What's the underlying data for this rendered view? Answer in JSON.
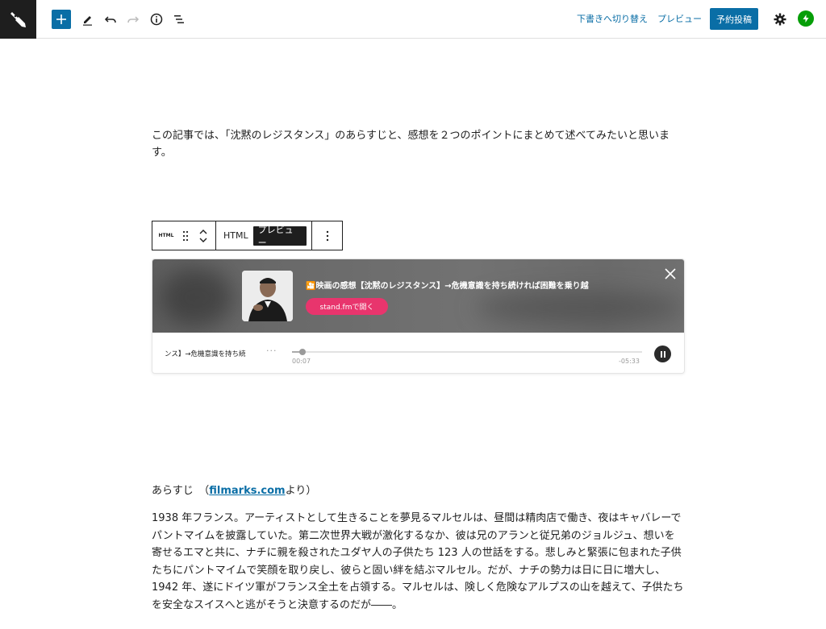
{
  "toolbar": {
    "switch_to_draft_label": "下書きへ切り替え",
    "preview_label": "プレビュー",
    "schedule_label": "予約投稿"
  },
  "content": {
    "intro": "この記事では、「沈黙のレジスタンス」のあらすじと、感想を２つのポイントにまとめて述べてみたいと思います。",
    "synopsis_heading_prefix": "あらすじ　（",
    "synopsis_link": "filmarks.com",
    "synopsis_heading_suffix": "より）",
    "synopsis_body": "1938 年フランス。アーティストとして生きることを夢見るマルセルは、昼間は精肉店で働き、夜はキャバレーでパントマイムを披露していた。第二次世界大戦が激化するなか、彼は兄のアランと従兄弟のジョルジュ、想いを寄せるエマと共に、ナチに親を殺されたユダヤ人の子供たち 123 人の世話をする。悲しみと緊張に包まれた子供たちにパントマイムで笑顔を取り戻し、彼らと固い絆を結ぶマルセル。だが、ナチの勢力は日に日に増大し、1942 年、遂にドイツ軍がフランス全土を占領する。マルセルは、険しく危険なアルプスの山を越えて、子供たちを安全なスイスへと逃がそうと決意するのだが――。"
  },
  "block_toolbar": {
    "block_icon_label": "HTML",
    "tab_html": "HTML",
    "tab_preview": "プレビュー"
  },
  "embed": {
    "title": "🎦映画の感想【沈黙のレジスタンス】→危機意識を持ち続ければ困難を乗り越",
    "button_label": "stand.fmで開く",
    "track_title": "ンス】→危機意識を持ち続",
    "dots": "···",
    "time_current": "00:07",
    "time_remaining": "-05:33",
    "progress": 0.03
  },
  "colors": {
    "accent": "#0a6ea6",
    "standfm_pink": "#e8356d",
    "jetpack_green": "#069e08"
  },
  "icons": [
    "wordpress-logo-icon",
    "plus-icon",
    "pencil-icon",
    "undo-icon",
    "redo-icon",
    "info-icon",
    "list-view-icon",
    "gear-icon",
    "jetpack-icon",
    "drag-handle-icon",
    "chevron-up-icon",
    "chevron-down-icon",
    "more-vertical-icon",
    "close-icon",
    "pause-icon"
  ]
}
